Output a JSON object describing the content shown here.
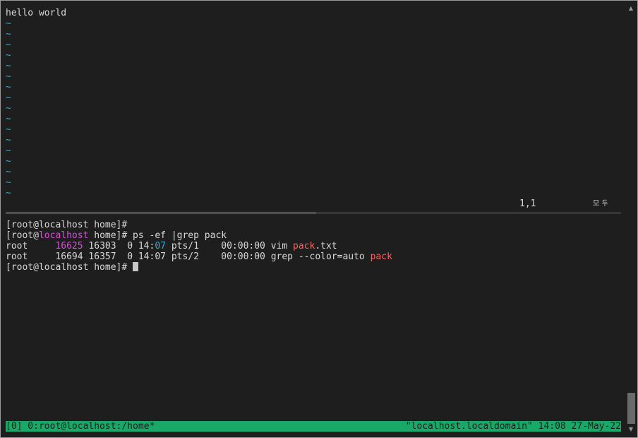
{
  "vim": {
    "buffer_line": "hello world",
    "tilde": "~",
    "ruler": "1,1",
    "mode_indicator": "모 두"
  },
  "shell": {
    "prompt": "[root@localhost home]#",
    "prompt_parts": {
      "open": "[root@",
      "host": "localhost",
      "close": " home]#"
    },
    "command": " ps -ef |grep pack",
    "ps_rows": [
      {
        "user": "root     ",
        "pid": "16625",
        "rest": " 16303  0 14:",
        "minutes": "07",
        "tail": " pts/1    00:00:00 vim ",
        "match": "pack",
        "suffix": ".txt"
      },
      {
        "user": "root     ",
        "pid": "16694",
        "rest": " 16357  0 14:",
        "minutes": "07",
        "tail": " pts/2    00:00:00 grep --color=auto ",
        "match": "pack",
        "suffix": ""
      }
    ]
  },
  "tmux": {
    "window_list": "[0] 0:root@localhost:/home*",
    "status_right": "\"localhost.localdomain\" 14:08 27-May-22"
  },
  "colors": {
    "background": "#1e1e1e",
    "foreground": "#d8d8d8",
    "tilde": "#3aa6c9",
    "highlight_magenta": "#d451d6",
    "grep_match": "#ef6666",
    "tmux_status": "#1aa868"
  },
  "icons": {
    "scroll_up": "triangle-up",
    "scroll_down": "triangle-down"
  }
}
